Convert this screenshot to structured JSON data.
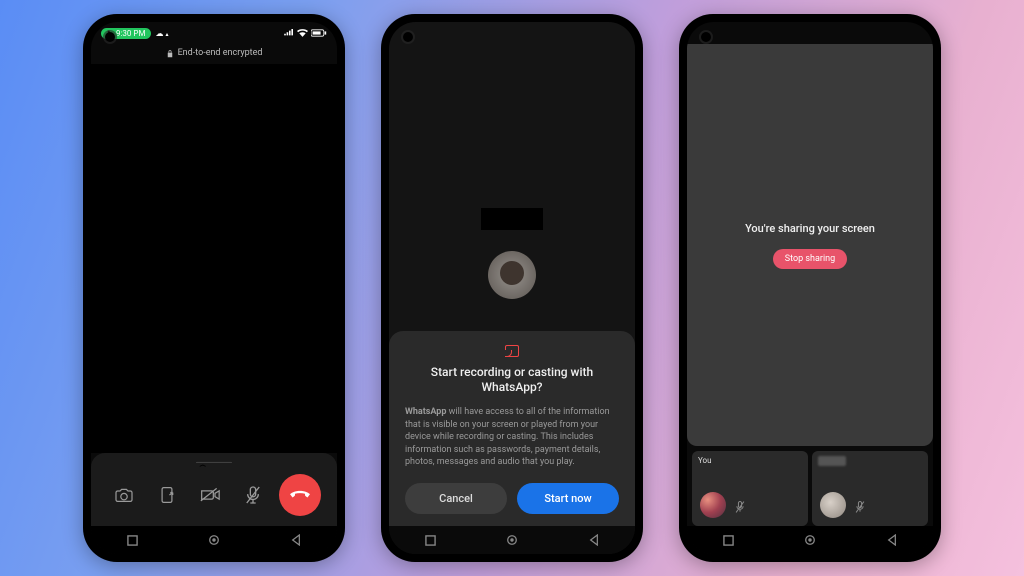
{
  "phone1": {
    "status": {
      "time": "9:30 PM",
      "indicators": "☁ ☁"
    },
    "encrypt_label": "End-to-end encrypted"
  },
  "phone2": {
    "sheet": {
      "title": "Start recording or casting with WhatsApp?",
      "body_bold": "WhatsApp",
      "body_rest": " will have access to all of the information that is visible on your screen or played from your device while recording or casting. This includes information such as passwords, payment details, photos, messages and audio that you play.",
      "cancel": "Cancel",
      "start": "Start now"
    }
  },
  "phone3": {
    "sharing_label": "You're sharing your screen",
    "stop_label": "Stop sharing",
    "tiles": {
      "you": "You"
    }
  }
}
